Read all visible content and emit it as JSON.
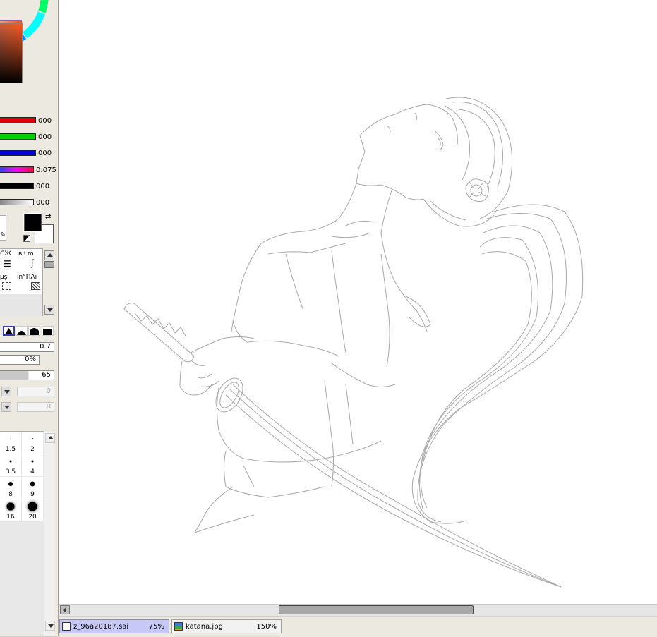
{
  "color": {
    "sliders": [
      {
        "name": "red",
        "value": "000",
        "color": "#e00000"
      },
      {
        "name": "green",
        "value": "000",
        "color": "#00d000"
      },
      {
        "name": "blue",
        "value": "000",
        "color": "#0000e0"
      },
      {
        "name": "hue",
        "value": "0:075",
        "color": "#ff00ff"
      },
      {
        "name": "value",
        "value": "000",
        "color": "#000000"
      },
      {
        "name": "alpha",
        "value": "000",
        "color": "#bdbdbd"
      }
    ],
    "foreground": "#000000",
    "background": "#ffffff"
  },
  "tools": {
    "row1": [
      "СЖ",
      "в±m"
    ],
    "row2": [
      "μş",
      "in°ПAï"
    ]
  },
  "brush_settings": {
    "size": "0.7",
    "density": "0%",
    "min_size": "65",
    "field_a": "0",
    "field_b": "0"
  },
  "brush_sizes": [
    "1.5",
    "2",
    "3.5",
    "4",
    "8",
    "9",
    "16",
    "20"
  ],
  "tabs": [
    {
      "name": "z_96a20187.sai",
      "zoom": "75%",
      "active": true
    },
    {
      "name": "katana.jpg",
      "zoom": "150%",
      "active": false
    }
  ]
}
